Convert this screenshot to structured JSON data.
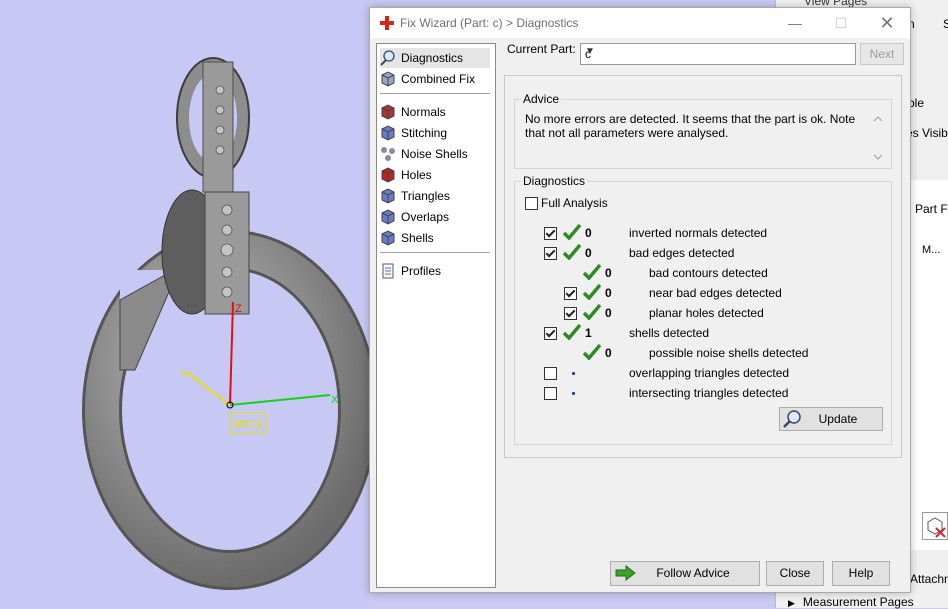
{
  "viewport": {
    "wcs_label": "WCS",
    "axis_x": "X",
    "axis_y": "Y",
    "axis_z": "Z"
  },
  "right_pane": {
    "top_partial": "View Pages",
    "col_n": "n",
    "col_s": "S",
    "text_ble": "ble",
    "text_visible": "es Visible",
    "text_partf": "Part F",
    "col_m": "M...",
    "text_attach": "Attachm",
    "measurement_pages": "Measurement Pages"
  },
  "dialog": {
    "title": "Fix Wizard (Part: c) > Diagnostics",
    "sidebar": {
      "top": [
        {
          "label": "Diagnostics",
          "icon": "magnifier-icon",
          "selected": true
        },
        {
          "label": "Combined Fix",
          "icon": "cube-icon"
        }
      ],
      "tools": [
        {
          "label": "Normals",
          "icon": "normals-cube-icon"
        },
        {
          "label": "Stitching",
          "icon": "stitching-cube-icon"
        },
        {
          "label": "Noise Shells",
          "icon": "noise-shells-icon"
        },
        {
          "label": "Holes",
          "icon": "holes-cube-icon"
        },
        {
          "label": "Triangles",
          "icon": "triangles-cube-icon"
        },
        {
          "label": "Overlaps",
          "icon": "overlaps-cube-icon"
        },
        {
          "label": "Shells",
          "icon": "shells-cube-icon"
        }
      ],
      "bottom": [
        {
          "label": "Profiles",
          "icon": "profiles-document-icon"
        }
      ]
    },
    "current_part_label": "Current Part:",
    "current_part_value": "c",
    "next_label": "Next",
    "advice_title": "Advice",
    "advice_text": "No more errors are detected. It seems that the part is ok. Note that not all parameters were analysed.",
    "diagnostics_title": "Diagnostics",
    "full_analysis_label": "Full Analysis",
    "rows": [
      {
        "text": "inverted normals detected",
        "count": "0",
        "checked": true,
        "status": "ok",
        "indent": 0
      },
      {
        "text": "bad edges detected",
        "count": "0",
        "checked": true,
        "status": "ok",
        "indent": 0
      },
      {
        "text": "bad contours detected",
        "count": "0",
        "checked": null,
        "status": "ok",
        "indent": 1
      },
      {
        "text": "near bad edges detected",
        "count": "0",
        "checked": true,
        "status": "ok",
        "indent": 1
      },
      {
        "text": "planar holes detected",
        "count": "0",
        "checked": true,
        "status": "ok",
        "indent": 1
      },
      {
        "text": "shells detected",
        "count": "1",
        "checked": true,
        "status": "ok",
        "indent": 0
      },
      {
        "text": "possible noise shells detected",
        "count": "0",
        "checked": null,
        "status": "ok",
        "indent": 1
      },
      {
        "text": "overlapping triangles detected",
        "count": "",
        "checked": false,
        "status": "not-run",
        "indent": 0
      },
      {
        "text": "intersecting triangles detected",
        "count": "",
        "checked": false,
        "status": "not-run",
        "indent": 0
      }
    ],
    "update_label": "Update",
    "follow_advice_label": "Follow Advice",
    "close_label": "Close",
    "help_label": "Help"
  },
  "colors": {
    "check_green": "#2e8b22",
    "accent_red": "#d4261c",
    "follow_arrow": "#3da12c"
  }
}
